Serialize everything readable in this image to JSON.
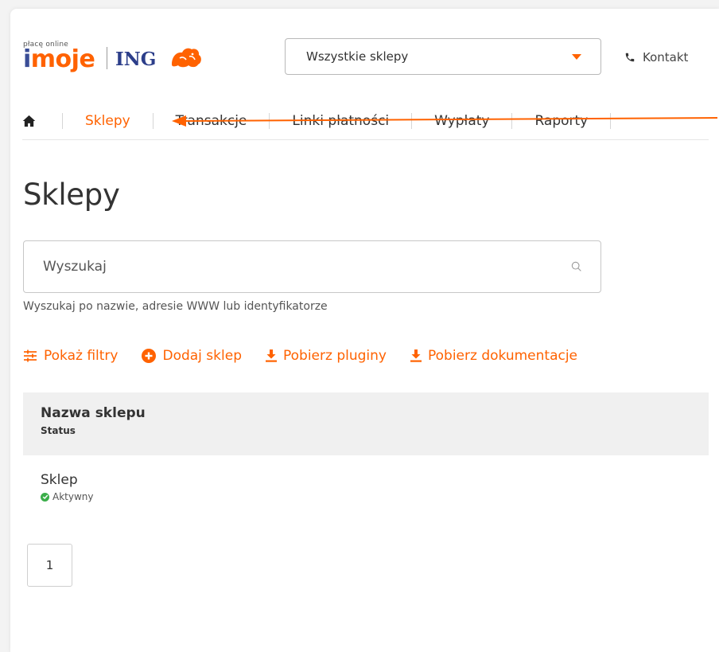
{
  "brand": {
    "tagline": "płacę online",
    "name": "imoje",
    "bank": "ING",
    "colors": {
      "accent": "#ff6200",
      "ing_blue": "#2c3e8a",
      "status_active": "#3bae4a"
    }
  },
  "header": {
    "store_select": {
      "value": "Wszystkie sklepy"
    },
    "contact_label": "Kontakt"
  },
  "nav": {
    "items": [
      {
        "label": "Sklepy",
        "active": true
      },
      {
        "label": "Transakcje",
        "active": false
      },
      {
        "label": "Linki płatności",
        "active": false
      },
      {
        "label": "Wypłaty",
        "active": false
      },
      {
        "label": "Raporty",
        "active": false
      }
    ]
  },
  "page": {
    "title": "Sklepy"
  },
  "search": {
    "placeholder": "Wyszukaj",
    "value": "",
    "hint": "Wyszukaj po nazwie, adresie WWW lub identyfikatorze"
  },
  "actions": {
    "show_filters": "Pokaż filtry",
    "add_store": "Dodaj sklep",
    "download_plugins": "Pobierz pluginy",
    "download_docs": "Pobierz dokumentacje"
  },
  "table": {
    "headers": {
      "name": "Nazwa sklepu",
      "status": "Status"
    },
    "rows": [
      {
        "name": "Sklep",
        "status": "Aktywny"
      }
    ]
  },
  "pagination": {
    "current_page": "1"
  }
}
